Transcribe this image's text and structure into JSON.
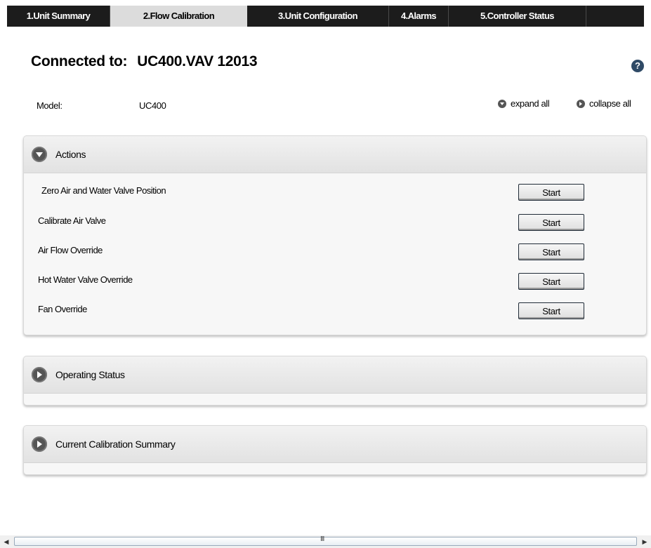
{
  "tabs": [
    {
      "label": "1.Unit Summary",
      "active": false
    },
    {
      "label": "2.Flow Calibration",
      "active": true
    },
    {
      "label": "3.Unit Configuration",
      "active": false
    },
    {
      "label": "4.Alarms",
      "active": false
    },
    {
      "label": "5.Controller Status",
      "active": false
    }
  ],
  "header": {
    "connected_label": "Connected to:",
    "device": "UC400.VAV 12013",
    "help_icon": "?"
  },
  "model": {
    "label": "Model:",
    "value": "UC400"
  },
  "controls": {
    "expand_all": "expand all",
    "collapse_all": "collapse all"
  },
  "panels": {
    "actions": {
      "title": "Actions",
      "expanded": true,
      "rows": [
        {
          "label": "Zero Air and Water Valve Position",
          "button": "Start"
        },
        {
          "label": "Calibrate Air Valve",
          "button": "Start"
        },
        {
          "label": "Air Flow Override",
          "button": "Start"
        },
        {
          "label": "Hot Water Valve Override",
          "button": "Start"
        },
        {
          "label": "Fan Override",
          "button": "Start"
        }
      ]
    },
    "operating_status": {
      "title": "Operating Status",
      "expanded": false
    },
    "calibration_summary": {
      "title": "Current Calibration Summary",
      "expanded": false
    }
  },
  "scrollbar": {
    "left_arrow": "◀",
    "right_arrow": "▶",
    "grip": "III"
  },
  "colors": {
    "tab_bar": "#1c1c1c",
    "active_tab": "#dcdcdc",
    "panel_bg": "#f7f7f7",
    "button_border": "#1f2a36"
  }
}
